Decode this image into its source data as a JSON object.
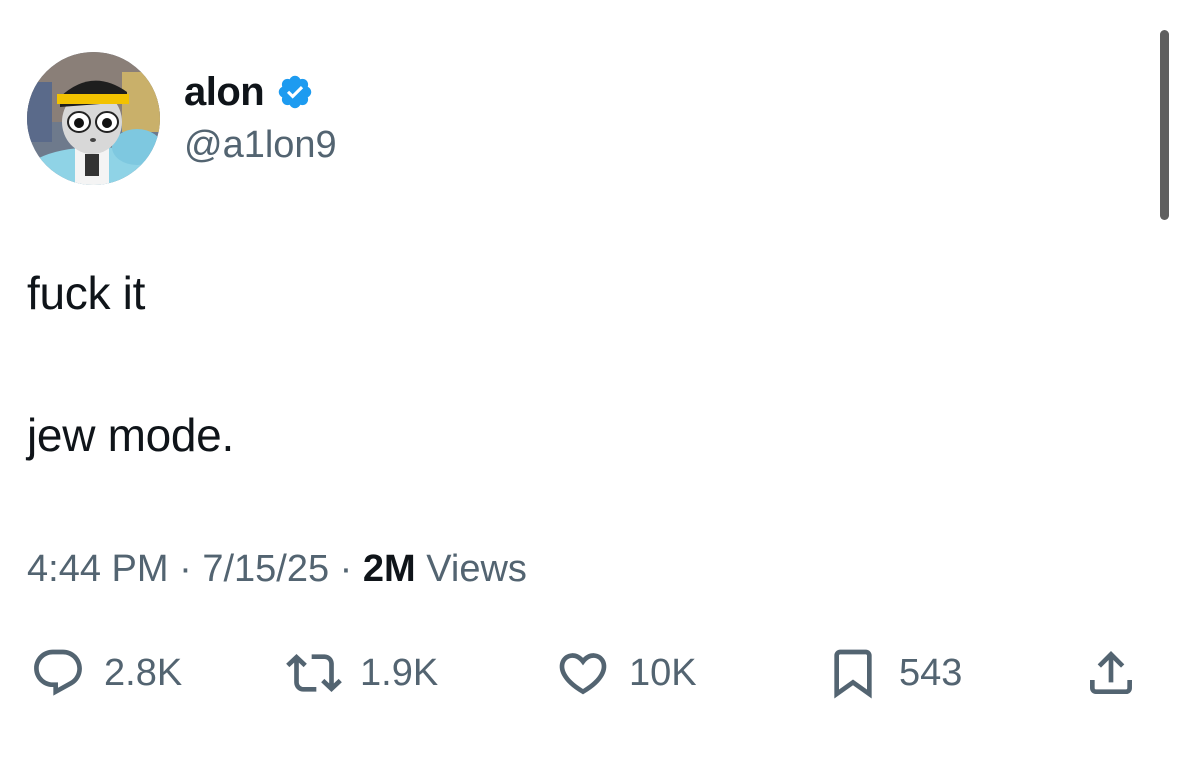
{
  "author": {
    "display_name": "alon",
    "handle": "@a1lon9",
    "verified": true,
    "avatar_icon": "avatar-icon",
    "verified_icon": "verified-badge-icon",
    "colors": {
      "verified_badge": "#1d9bf0",
      "handle": "#536471"
    }
  },
  "tweet": {
    "lines": [
      "fuck it",
      "jew mode."
    ]
  },
  "meta": {
    "time": "4:44 PM",
    "separator": "·",
    "date": "7/15/25",
    "views_count": "2M",
    "views_label": "Views"
  },
  "actions": {
    "reply": {
      "icon": "reply-icon",
      "count": "2.8K"
    },
    "repost": {
      "icon": "repost-icon",
      "count": "1.9K"
    },
    "like": {
      "icon": "heart-icon",
      "count": "10K"
    },
    "bookmark": {
      "icon": "bookmark-icon",
      "count": "543"
    },
    "share": {
      "icon": "share-icon"
    }
  },
  "colors": {
    "text_primary": "#0f1419",
    "text_secondary": "#536471",
    "icon": "#536471",
    "background": "#ffffff"
  }
}
